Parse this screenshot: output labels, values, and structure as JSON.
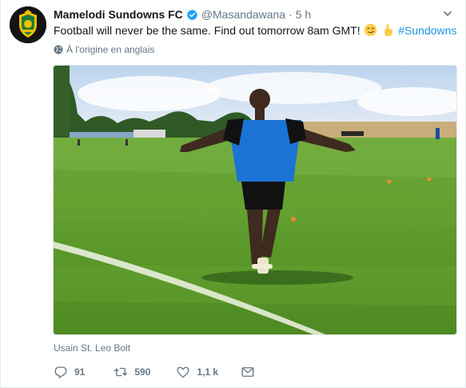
{
  "tweet": {
    "author_name": "Mamelodi Sundowns FC",
    "handle": "@Masandawana",
    "separator": "·",
    "time": "5 h",
    "text_main": "Football will never be the same. Find out tomorrow 8am GMT!",
    "hashtag": "#Sundowns",
    "translate_label": "À l'origine en anglais",
    "media_caption": "Usain St. Leo Bolt",
    "counts": {
      "replies": "91",
      "retweets": "590",
      "likes": "1,1 k"
    }
  },
  "icons": {
    "avatar": "sundowns-crest",
    "verified": "verified-badge-icon",
    "caret": "chevron-down-icon",
    "emoji_1": "smirking-face",
    "emoji_2": "pointing-up-hand",
    "globe": "globe-icon",
    "reply": "reply-icon",
    "retweet": "retweet-icon",
    "like": "heart-icon",
    "dm": "envelope-icon"
  },
  "colors": {
    "link": "#1b95e0",
    "muted": "#657786",
    "text": "#14171a",
    "verified": "#1da1f2"
  }
}
